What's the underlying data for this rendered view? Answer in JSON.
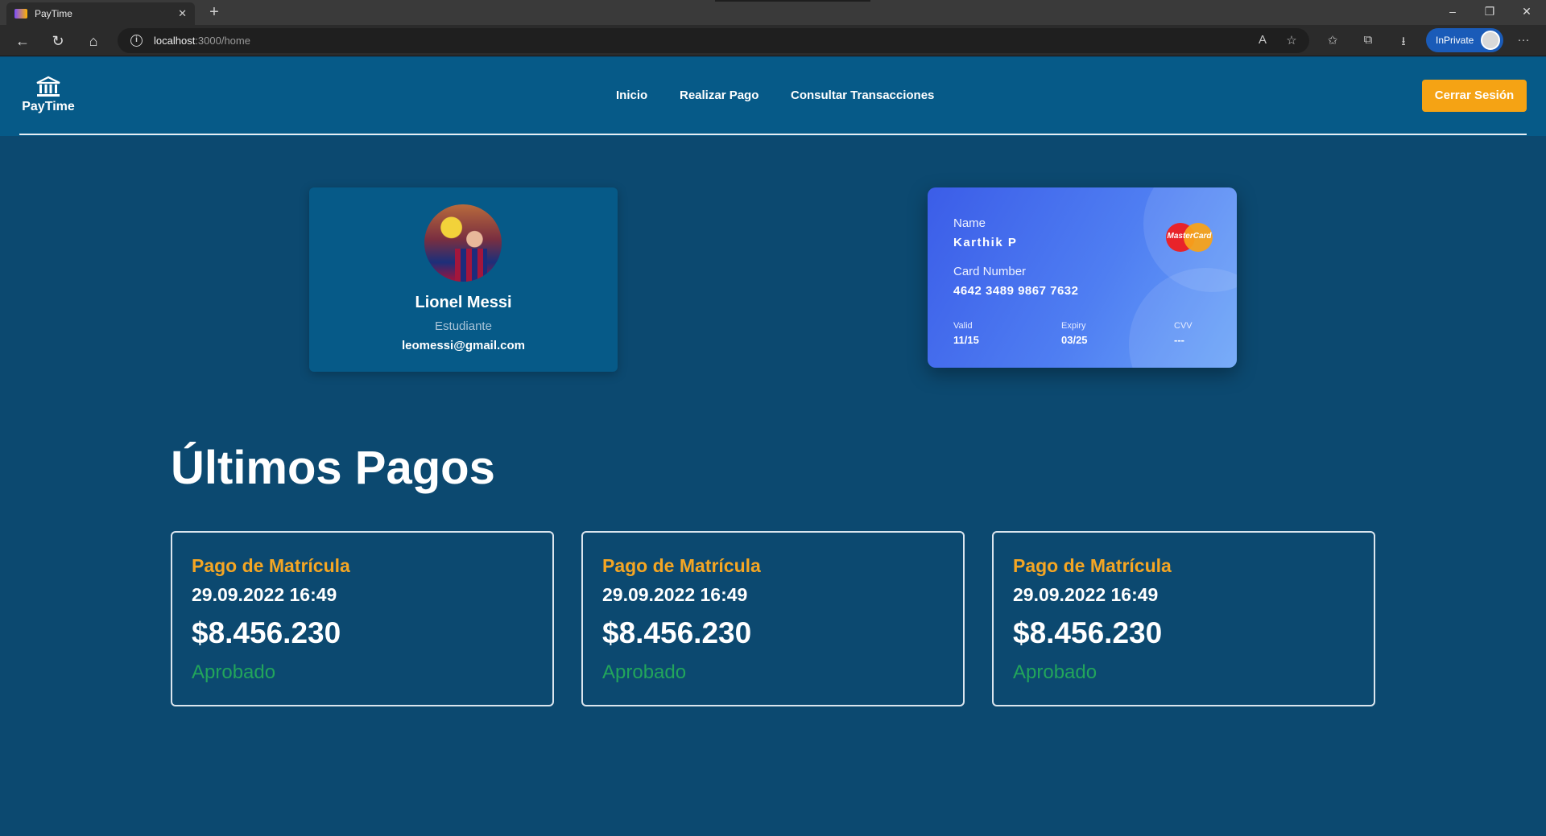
{
  "browser": {
    "tab_title": "PayTime",
    "url_host": "localhost",
    "url_path": ":3000/home",
    "inprivate_label": "InPrivate"
  },
  "app": {
    "brand": "PayTime",
    "nav": [
      "Inicio",
      "Realizar Pago",
      "Consultar Transacciones"
    ],
    "logout_label": "Cerrar Sesión"
  },
  "profile": {
    "name": "Lionel Messi",
    "role": "Estudiante",
    "email": "leomessi@gmail.com"
  },
  "card": {
    "name_label": "Name",
    "name": "Karthik P",
    "number_label": "Card Number",
    "number": "4642 3489 9867 7632",
    "valid_label": "Valid",
    "valid": "11/15",
    "expiry_label": "Expiry",
    "expiry": "03/25",
    "cvv_label": "CVV",
    "cvv": "---",
    "brand": "MasterCard"
  },
  "payments": {
    "title": "Últimos Pagos",
    "items": [
      {
        "title": "Pago de Matrícula",
        "date": "29.09.2022 16:49",
        "amount": "$8.456.230",
        "status": "Aprobado"
      },
      {
        "title": "Pago de Matrícula",
        "date": "29.09.2022 16:49",
        "amount": "$8.456.230",
        "status": "Aprobado"
      },
      {
        "title": "Pago de Matrícula",
        "date": "29.09.2022 16:49",
        "amount": "$8.456.230",
        "status": "Aprobado"
      }
    ]
  },
  "colors": {
    "page_bg": "#0c4970",
    "header_bg": "#065a88",
    "accent": "#f5a314",
    "approved": "#22a55b"
  }
}
